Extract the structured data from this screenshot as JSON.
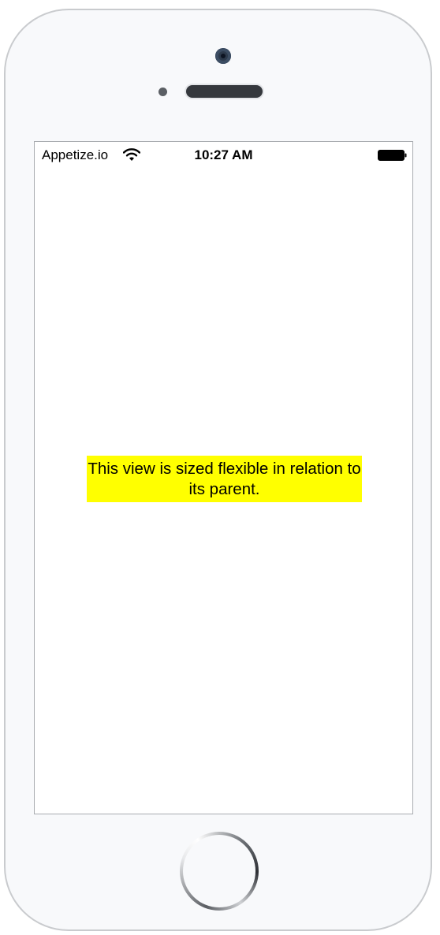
{
  "status_bar": {
    "carrier": "Appetize.io",
    "time": "10:27 AM",
    "wifi_icon": "wifi-icon",
    "battery_icon": "battery-full-icon"
  },
  "content": {
    "label_text": "This view is sized flexible in relation to its parent.",
    "label_background": "#ffff00"
  },
  "device": {
    "frame_color": "#f8f9fb",
    "home_button_icon": "home-button"
  }
}
